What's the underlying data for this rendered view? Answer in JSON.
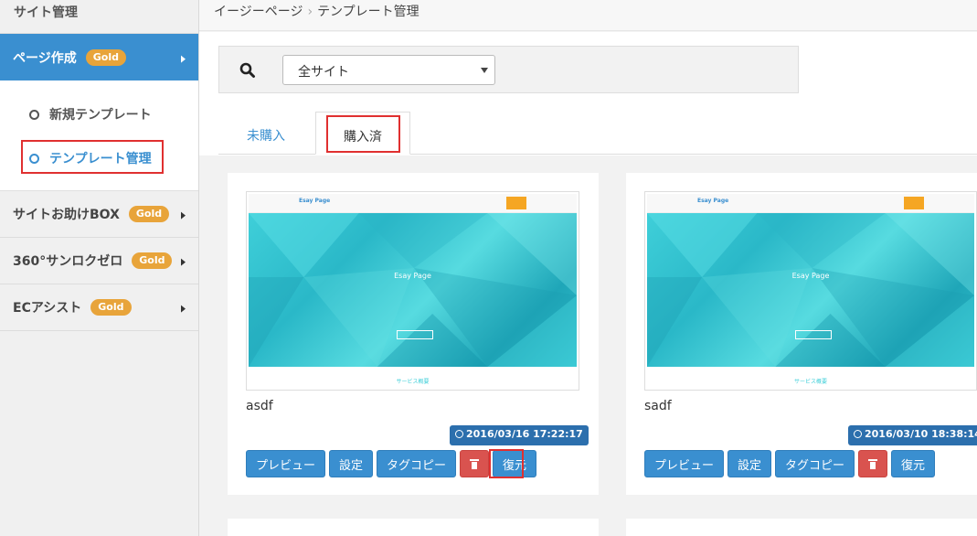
{
  "sidebar": {
    "title": "サイト管理",
    "active_item": {
      "label": "ページ作成",
      "badge": "Gold"
    },
    "sub_items": [
      {
        "label": "新規テンプレート"
      },
      {
        "label": "テンプレート管理"
      }
    ],
    "items": [
      {
        "label": "サイトお助けBOX",
        "badge": "Gold"
      },
      {
        "label": "360°サンロクゼロ",
        "badge": "Gold"
      },
      {
        "label": "ECアシスト",
        "badge": "Gold"
      }
    ]
  },
  "breadcrumb": {
    "root": "イージーページ",
    "separator": "›",
    "current": "テンプレート管理"
  },
  "search": {
    "select_value": "全サイト"
  },
  "tabs": [
    {
      "label": "未購入"
    },
    {
      "label": "購入済"
    }
  ],
  "cards": [
    {
      "title": "asdf",
      "date": "2016/03/16 17:22:17",
      "thumb": {
        "logo": "Esay Page",
        "hero_title": "Esay Page",
        "footer": "サービス概要"
      },
      "buttons": {
        "preview": "プレビュー",
        "settings": "設定",
        "tag_copy": "タグコピー",
        "restore": "復元"
      }
    },
    {
      "title": "sadf",
      "date": "2016/03/10 18:38:14",
      "thumb": {
        "logo": "Esay Page",
        "hero_title": "Esay Page",
        "footer": "サービス概要"
      },
      "buttons": {
        "preview": "プレビュー",
        "settings": "設定",
        "tag_copy": "タグコピー",
        "restore": "復元"
      }
    }
  ],
  "colors": {
    "accent": "#3a8fd0",
    "badge": "#e8a43a",
    "danger": "#d9534f",
    "date_badge": "#2c6fad",
    "highlight": "#e03030"
  }
}
